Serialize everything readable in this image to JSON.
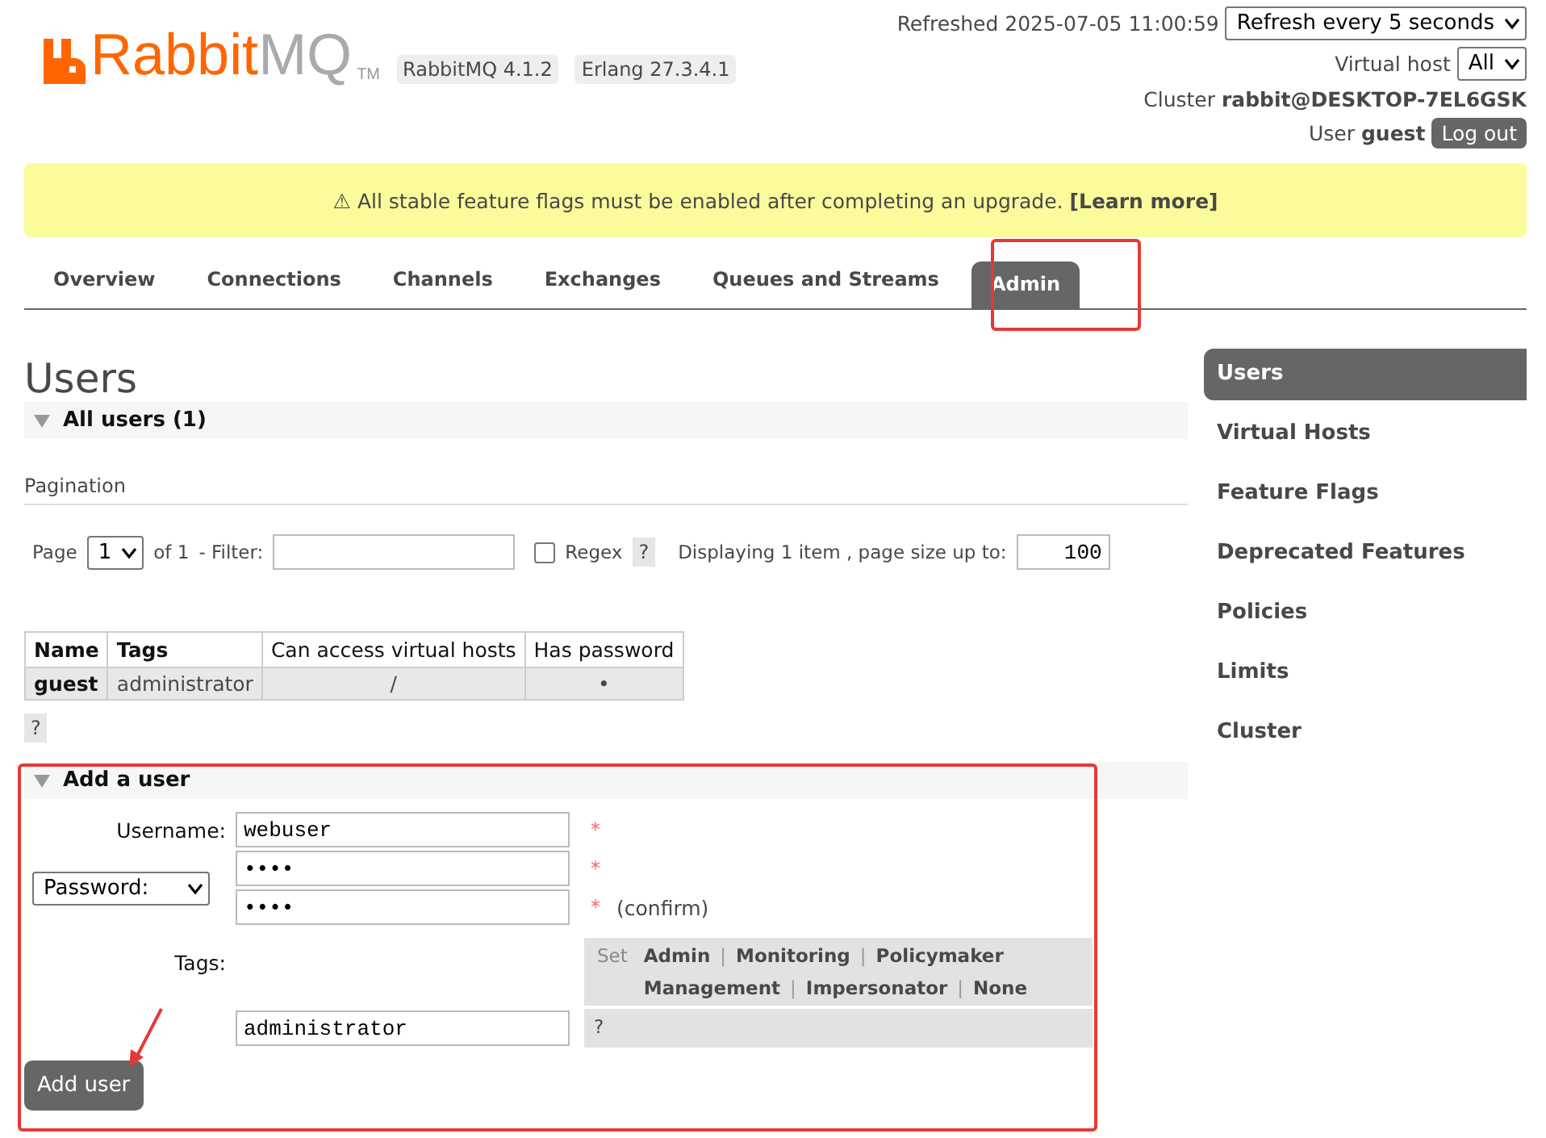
{
  "logo": {
    "primary": "Rabbit",
    "secondary": "MQ",
    "mark": "TM"
  },
  "versions": [
    "RabbitMQ 4.1.2",
    "Erlang 27.3.4.1"
  ],
  "header": {
    "refreshed": "Refreshed 2025-07-05 11:00:59",
    "refresh_option": "Refresh every 5 seconds",
    "vhost_label": "Virtual host",
    "vhost_option": "All",
    "cluster_label": "Cluster",
    "cluster": "rabbit@DESKTOP-7EL6GSK",
    "user_label": "User",
    "user": "guest",
    "logout": "Log out"
  },
  "banner": {
    "icon": "⚠",
    "text": "All stable feature flags must be enabled after completing an upgrade.",
    "link": "[Learn more]"
  },
  "tabs": [
    {
      "label": "Overview",
      "selected": false
    },
    {
      "label": "Connections",
      "selected": false
    },
    {
      "label": "Channels",
      "selected": false
    },
    {
      "label": "Exchanges",
      "selected": false
    },
    {
      "label": "Queues and Streams",
      "selected": false
    },
    {
      "label": "Admin",
      "selected": true
    }
  ],
  "page_title": "Users",
  "all_users": {
    "title": "All users (1)",
    "expanded": true,
    "pagination_label": "Pagination",
    "page_label": "Page",
    "page_value": "1",
    "of": "of 1",
    "filter_label": "- Filter:",
    "regex_label": "Regex",
    "regex_checked": false,
    "help": "?",
    "displaying": "Displaying 1 item , page size up to:",
    "page_size": "100",
    "columns": [
      "Name",
      "Tags",
      "Can access virtual hosts",
      "Has password"
    ],
    "rows": [
      [
        "guest",
        "administrator",
        "/",
        "•"
      ]
    ],
    "table_help": "?"
  },
  "add_user": {
    "title": "Add a user",
    "expanded": true,
    "username_label": "Username:",
    "username": "webuser",
    "required": "*",
    "password_option": "Password:",
    "password": "••••",
    "password_confirm": "••••",
    "confirm": "(confirm)",
    "tags_label": "Tags:",
    "set_label": "Set",
    "tag_links": [
      [
        "Admin",
        "Monitoring",
        "Policymaker"
      ],
      [
        "Management",
        "Impersonator",
        "None"
      ]
    ],
    "separator": "|",
    "tags_value": "administrator",
    "help": "?",
    "submit": "Add user"
  },
  "sidebar": [
    {
      "label": "Users",
      "selected": true
    },
    {
      "label": "Virtual Hosts",
      "selected": false
    },
    {
      "label": "Feature Flags",
      "selected": false
    },
    {
      "label": "Deprecated Features",
      "selected": false
    },
    {
      "label": "Policies",
      "selected": false
    },
    {
      "label": "Limits",
      "selected": false
    },
    {
      "label": "Cluster",
      "selected": false
    }
  ]
}
